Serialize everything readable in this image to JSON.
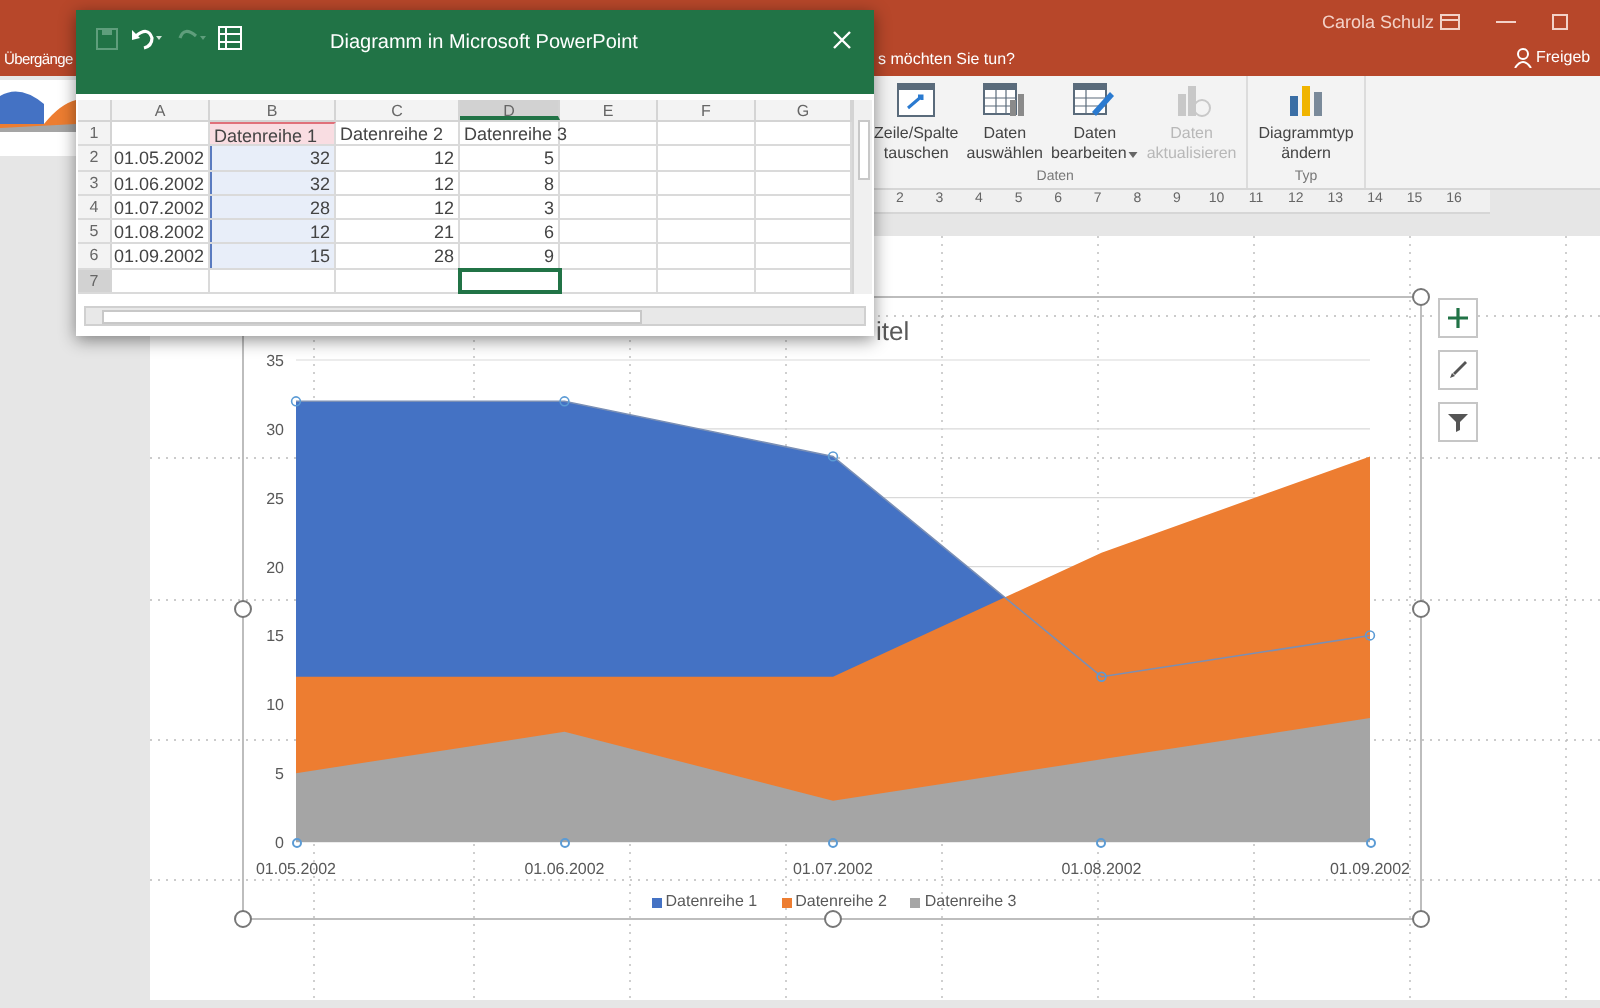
{
  "app": {
    "user": "Carola Schulz",
    "tab_fragment": "Übergänge",
    "tell_me": "s möchten Sie tun?",
    "share": "Freigeb"
  },
  "ribbon": {
    "groups": [
      {
        "label": "Daten",
        "buttons": [
          {
            "kind": "swap",
            "lines": [
              "Zeile/Spalte",
              "tauschen"
            ],
            "disabled": false,
            "has_menu": false
          },
          {
            "kind": "select",
            "lines": [
              "Daten",
              "auswählen"
            ],
            "disabled": false,
            "has_menu": false
          },
          {
            "kind": "edit",
            "lines": [
              "Daten",
              "bearbeiten"
            ],
            "disabled": false,
            "has_menu": true
          },
          {
            "kind": "refresh",
            "lines": [
              "Daten",
              "aktualisieren"
            ],
            "disabled": true,
            "has_menu": false
          }
        ]
      },
      {
        "label": "Typ",
        "buttons": [
          {
            "kind": "charttype",
            "lines": [
              "Diagrammtyp",
              "ändern"
            ],
            "disabled": false,
            "has_menu": false
          }
        ]
      }
    ]
  },
  "ruler": [
    "2",
    "3",
    "4",
    "5",
    "6",
    "7",
    "8",
    "9",
    "10",
    "11",
    "12",
    "13",
    "14",
    "15",
    "16"
  ],
  "spreadsheet": {
    "title": "Diagramm in Microsoft PowerPoint",
    "columns": [
      {
        "label": "A",
        "selected": false,
        "highlighted": false
      },
      {
        "label": "B",
        "selected": false,
        "highlighted": true
      },
      {
        "label": "C",
        "selected": false,
        "highlighted": false
      },
      {
        "label": "D",
        "selected": true,
        "highlighted": false
      },
      {
        "label": "E",
        "selected": false,
        "highlighted": false
      },
      {
        "label": "F",
        "selected": false,
        "highlighted": false
      },
      {
        "label": "G",
        "selected": false,
        "highlighted": false
      }
    ],
    "rows": [
      {
        "header": "1",
        "kind": "header",
        "selected": false,
        "cells": [
          "",
          "Datenreihe 1",
          "Datenreihe 2",
          "Datenreihe 3"
        ]
      },
      {
        "header": "2",
        "kind": "data",
        "selected": false,
        "cells": [
          "01.05.2002",
          "32",
          "12",
          "5"
        ]
      },
      {
        "header": "3",
        "kind": "data",
        "selected": false,
        "cells": [
          "01.06.2002",
          "32",
          "12",
          "8"
        ]
      },
      {
        "header": "4",
        "kind": "data",
        "selected": false,
        "cells": [
          "01.07.2002",
          "28",
          "12",
          "3"
        ]
      },
      {
        "header": "5",
        "kind": "data",
        "selected": false,
        "cells": [
          "01.08.2002",
          "12",
          "21",
          "6"
        ]
      },
      {
        "header": "6",
        "kind": "data",
        "selected": false,
        "cells": [
          "01.09.2002",
          "15",
          "28",
          "9"
        ]
      },
      {
        "header": "7",
        "kind": "empty",
        "selected": true,
        "cells": []
      }
    ]
  },
  "chart": {
    "chart_data": {
      "type": "area",
      "title": "itel",
      "categories": [
        "01.05.2002",
        "01.06.2002",
        "01.07.2002",
        "01.08.2002",
        "01.09.2002"
      ],
      "series": [
        {
          "name": "Datenreihe 1",
          "color": "#4472c4",
          "values": [
            32,
            32,
            28,
            12,
            15
          ]
        },
        {
          "name": "Datenreihe 2",
          "color": "#ed7d31",
          "values": [
            12,
            12,
            12,
            21,
            28
          ]
        },
        {
          "name": "Datenreihe 3",
          "color": "#a5a5a5",
          "values": [
            5,
            8,
            3,
            6,
            9
          ]
        }
      ],
      "ylim": [
        0,
        35
      ],
      "yticks": [
        0,
        5,
        10,
        15,
        20,
        25,
        30,
        35
      ],
      "stacked": false,
      "grid": true,
      "legend": "bottom"
    },
    "series_states": [
      {
        "selected": true
      },
      {
        "selected": false
      },
      {
        "selected": false
      }
    ]
  }
}
